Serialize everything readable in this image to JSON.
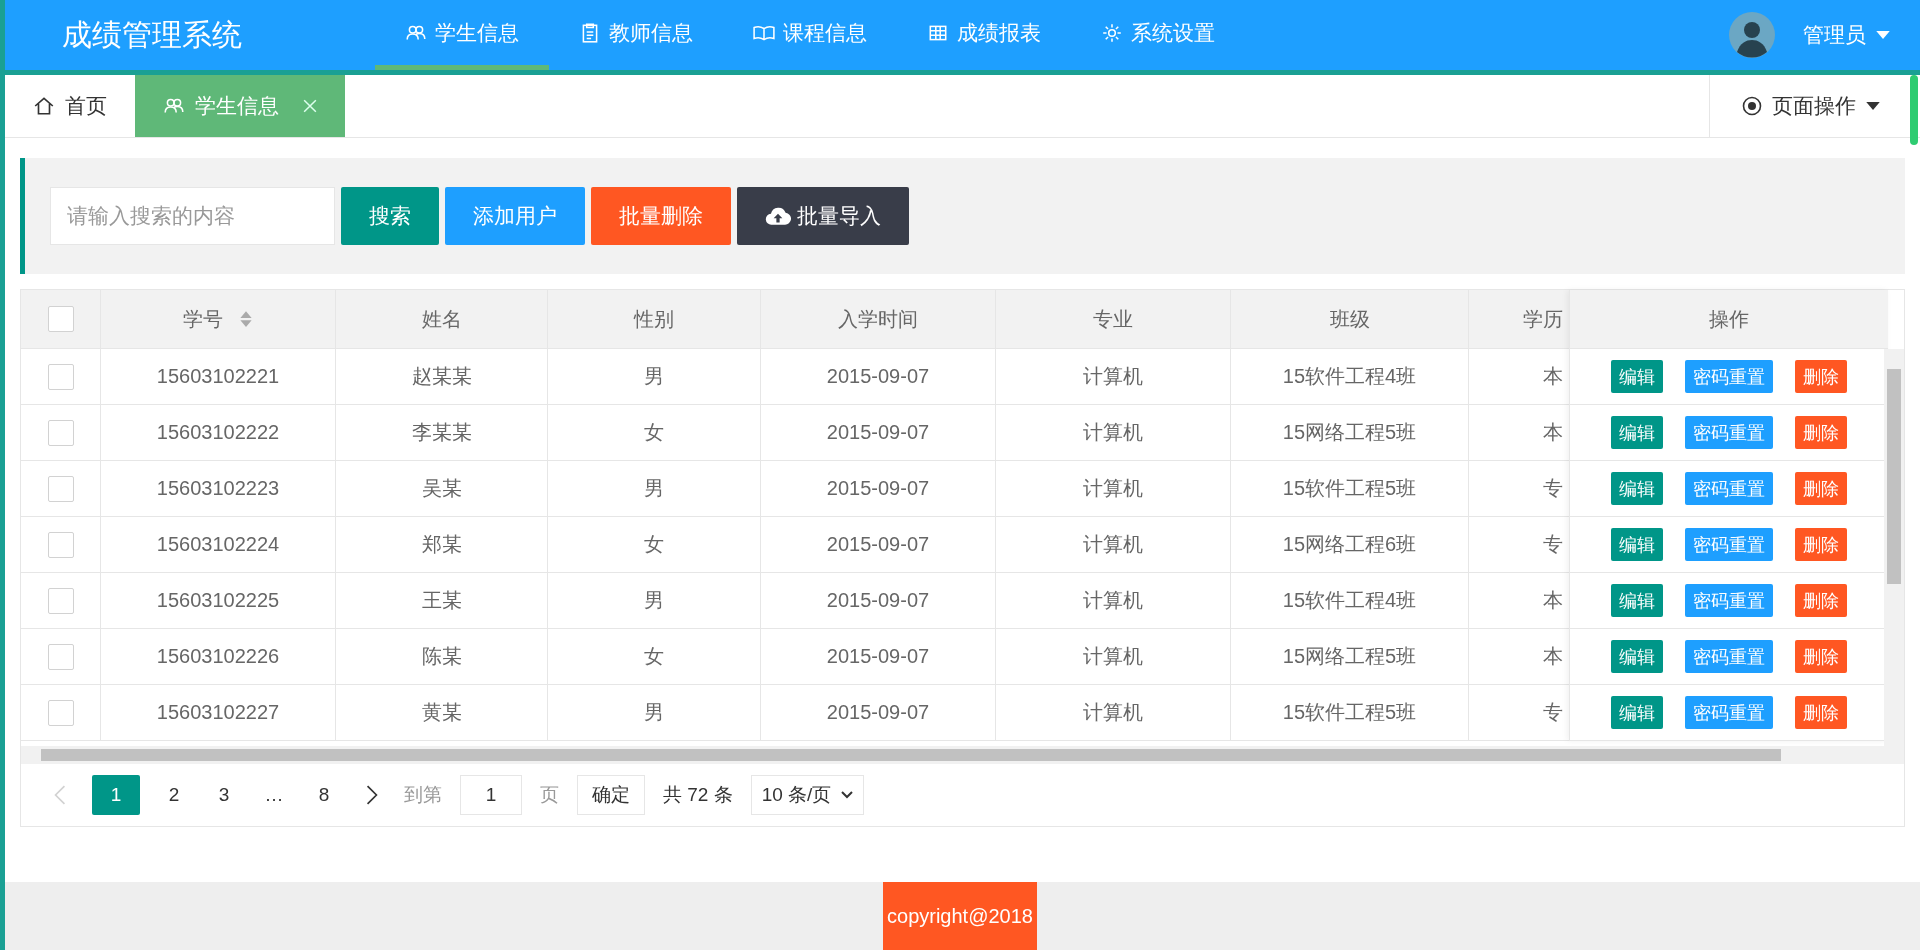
{
  "header": {
    "logo": "成绩管理系统",
    "nav": [
      {
        "label": "学生信息",
        "selected": true
      },
      {
        "label": "教师信息",
        "selected": false
      },
      {
        "label": "课程信息",
        "selected": false
      },
      {
        "label": "成绩报表",
        "selected": false
      },
      {
        "label": "系统设置",
        "selected": false
      }
    ],
    "user": "管理员"
  },
  "tabs": [
    {
      "label": "首页",
      "selected": false,
      "closable": false
    },
    {
      "label": "学生信息",
      "selected": true,
      "closable": true
    }
  ],
  "page_actions": "页面操作",
  "toolbar": {
    "search": {
      "placeholder": "请输入搜索的内容"
    },
    "buttons": [
      {
        "label": "搜索",
        "kind": "primary"
      },
      {
        "label": "添加用户",
        "kind": "normal"
      },
      {
        "label": "批量删除",
        "kind": "danger"
      },
      {
        "label": "批量导入",
        "kind": "upload"
      }
    ]
  },
  "table": {
    "all_checked": false,
    "columns": [
      {
        "label": "学号",
        "sortable": true
      },
      {
        "label": "姓名",
        "sortable": false
      },
      {
        "label": "性别",
        "sortable": false
      },
      {
        "label": "入学时间",
        "sortable": false
      },
      {
        "label": "专业",
        "sortable": false
      },
      {
        "label": "班级",
        "sortable": false
      },
      {
        "label": "学历",
        "sortable": false
      }
    ],
    "actions_column": "操作",
    "rows": [
      {
        "checked": false,
        "cells": [
          "15603102221",
          "赵某某",
          "男",
          "2015-09-07",
          "计算机",
          "15软件工程4班",
          "本"
        ],
        "actions": [
          {
            "label": "编辑",
            "kind": "edit"
          },
          {
            "label": "密码重置",
            "kind": "reset"
          },
          {
            "label": "删除",
            "kind": "delete"
          }
        ]
      },
      {
        "checked": false,
        "cells": [
          "15603102222",
          "李某某",
          "女",
          "2015-09-07",
          "计算机",
          "15网络工程5班",
          "本"
        ],
        "actions": [
          {
            "label": "编辑",
            "kind": "edit"
          },
          {
            "label": "密码重置",
            "kind": "reset"
          },
          {
            "label": "删除",
            "kind": "delete"
          }
        ]
      },
      {
        "checked": false,
        "cells": [
          "15603102223",
          "吴某",
          "男",
          "2015-09-07",
          "计算机",
          "15软件工程5班",
          "专"
        ],
        "actions": [
          {
            "label": "编辑",
            "kind": "edit"
          },
          {
            "label": "密码重置",
            "kind": "reset"
          },
          {
            "label": "删除",
            "kind": "delete"
          }
        ]
      },
      {
        "checked": false,
        "cells": [
          "15603102224",
          "郑某",
          "女",
          "2015-09-07",
          "计算机",
          "15网络工程6班",
          "专"
        ],
        "actions": [
          {
            "label": "编辑",
            "kind": "edit"
          },
          {
            "label": "密码重置",
            "kind": "reset"
          },
          {
            "label": "删除",
            "kind": "delete"
          }
        ]
      },
      {
        "checked": false,
        "cells": [
          "15603102225",
          "王某",
          "男",
          "2015-09-07",
          "计算机",
          "15软件工程4班",
          "本"
        ],
        "actions": [
          {
            "label": "编辑",
            "kind": "edit"
          },
          {
            "label": "密码重置",
            "kind": "reset"
          },
          {
            "label": "删除",
            "kind": "delete"
          }
        ]
      },
      {
        "checked": false,
        "cells": [
          "15603102226",
          "陈某",
          "女",
          "2015-09-07",
          "计算机",
          "15网络工程5班",
          "本"
        ],
        "actions": [
          {
            "label": "编辑",
            "kind": "edit"
          },
          {
            "label": "密码重置",
            "kind": "reset"
          },
          {
            "label": "删除",
            "kind": "delete"
          }
        ]
      },
      {
        "checked": false,
        "cells": [
          "15603102227",
          "黄某",
          "男",
          "2015-09-07",
          "计算机",
          "15软件工程5班",
          "专"
        ],
        "actions": [
          {
            "label": "编辑",
            "kind": "edit"
          },
          {
            "label": "密码重置",
            "kind": "reset"
          },
          {
            "label": "删除",
            "kind": "delete"
          }
        ]
      }
    ]
  },
  "pagination": {
    "prev_disabled": true,
    "pages": [
      {
        "label": "1",
        "selected": true
      },
      {
        "label": "2",
        "selected": false
      },
      {
        "label": "3",
        "selected": false
      },
      {
        "label": "…",
        "selected": false
      },
      {
        "label": "8",
        "selected": false
      }
    ],
    "goto_label": "到第",
    "goto_value": "1",
    "page_unit": "页",
    "confirm": "确定",
    "total": "共 72 条",
    "page_size": "10 条/页"
  },
  "footer": "copyright@2018"
}
